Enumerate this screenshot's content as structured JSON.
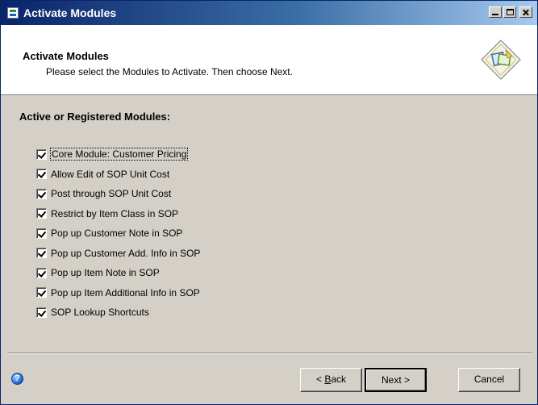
{
  "window": {
    "title": "Activate Modules",
    "controls": [
      "minimize-icon",
      "maximize-icon",
      "close-icon"
    ]
  },
  "header": {
    "title": "Activate Modules",
    "subtitle": "Please select the Modules to Activate.  Then choose Next."
  },
  "section": {
    "title": "Active or Registered Modules:"
  },
  "modules": [
    {
      "label": "Core Module: Customer Pricing",
      "checked": true
    },
    {
      "label": "Allow Edit of SOP Unit Cost",
      "checked": true
    },
    {
      "label": "Post through SOP Unit Cost",
      "checked": true
    },
    {
      "label": "Restrict by Item Class in SOP",
      "checked": true
    },
    {
      "label": "Pop up Customer Note in SOP",
      "checked": true
    },
    {
      "label": "Pop up Customer Add. Info in SOP",
      "checked": true
    },
    {
      "label": "Pop up Item Note in SOP",
      "checked": true
    },
    {
      "label": "Pop up Item Additional Info in SOP",
      "checked": true
    },
    {
      "label": "SOP Lookup Shortcuts",
      "checked": true
    }
  ],
  "footer": {
    "help_icon": "help-icon",
    "back_prefix": "< ",
    "back_mnemonic": "B",
    "back_rest": "ack",
    "next_label": "Next >",
    "cancel_label": "Cancel"
  },
  "colors": {
    "titlebar_start": "#0a246a",
    "titlebar_end": "#a6caf0",
    "dialog_bg": "#d4d0c8"
  }
}
